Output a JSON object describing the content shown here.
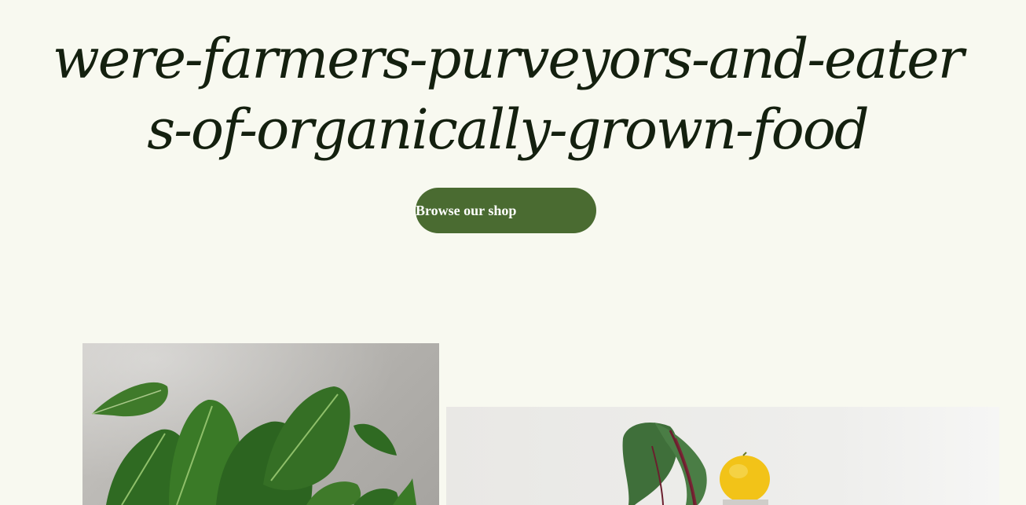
{
  "hero": {
    "title": "were-farmers-purveyors-and-eaters-of-organically-grown-food"
  },
  "cta": {
    "label": "Browse our shop"
  },
  "colors": {
    "background": "#f8f9f0",
    "title": "#14200f",
    "button": "#4a6b31",
    "button_text": "#ffffff"
  },
  "images": [
    {
      "subject": "leafy greens on stone surface"
    },
    {
      "subject": "beet with leaves and lemon"
    }
  ]
}
